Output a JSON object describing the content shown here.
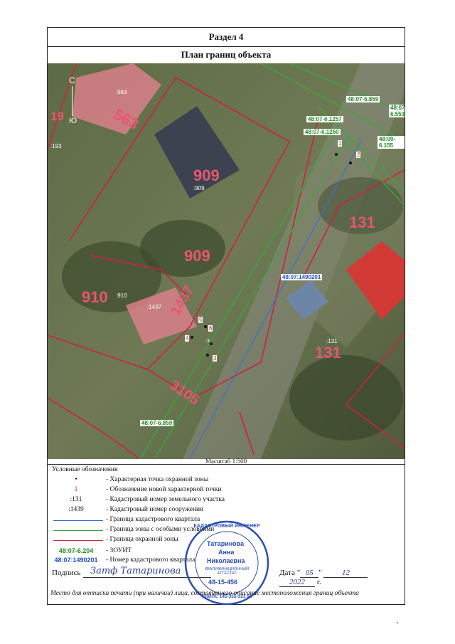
{
  "section": "Раздел 4",
  "title": "План границ объекта",
  "scale": "Масштаб 1:500",
  "legend": {
    "title": "Условные обозначения",
    "items": [
      {
        "symbol": "•",
        "text": "- Характерная точка охранной зоны"
      },
      {
        "symbol": "1",
        "text": "- Обозначение новой характерной точки"
      },
      {
        "symbol": ":131",
        "text": "- Кадастровый номер земельного участка"
      },
      {
        "symbol": ":1439",
        "text": "- Кадастровый номер сооружения"
      },
      {
        "symbol": "",
        "text": "- Граница кадастрового квартала"
      },
      {
        "symbol": "",
        "text": "- Граница зоны с особыми условиями"
      },
      {
        "symbol": "",
        "text": "- Граница охранной зоны"
      },
      {
        "symbol": "48:07-6.204",
        "text": "- ЗОУИТ"
      },
      {
        "symbol": "48:07:1490201",
        "text": "- Номер кадастрового квартала"
      }
    ]
  },
  "map": {
    "north": "С",
    "south": "Ю",
    "zones": [
      "48:07-6.859",
      "48:07-6.553",
      "48:07-6.1257",
      "48:07-6.1260",
      "48:00-6.155",
      "48:07-6.859"
    ],
    "quarter": "48:07:1490201",
    "parcels": [
      {
        "big": "563",
        "small": ":563"
      },
      {
        "big": "19",
        "small": ":193"
      },
      {
        "big": "909",
        "small": ":909"
      },
      {
        "big": "909",
        "small": ""
      },
      {
        "big": "910",
        "small": ":910"
      },
      {
        "big": "1437",
        "small": ":1437"
      },
      {
        "big": "131",
        "small": ""
      },
      {
        "big": "131",
        "small": ":131"
      },
      {
        "big": "3105",
        "small": ""
      }
    ],
    "points": [
      "1",
      "2",
      "3",
      "4",
      "5",
      "6"
    ],
    "extra": ":3"
  },
  "signature": {
    "label": "Подпись",
    "scribble": "Затф Татаринова",
    "date_label": "Дата",
    "day": "05",
    "month": "12",
    "year": "2022",
    "suffix": "г."
  },
  "stamp": {
    "ring_top": "КАДАСТРОВЫЙ ИНЖЕНЕР",
    "ring_bottom": "СНИЛС 145-355-323 94",
    "name1": "Татаринова",
    "name2": "Анна",
    "name3": "Николаевна",
    "cert": "КВАЛИФИКАЦИОННЫЙ АТТЕСТАТ",
    "number": "48-15-456"
  },
  "footer": "Место для оттиска печати (при наличии) лица, составившего описание местоположения границ объекта",
  "colors": {
    "quarter_line": "#3a6fd8",
    "zone_line": "#3aa83a",
    "guard_line": "#d02040",
    "zone_text": "#1f8a1f",
    "quarter_text": "#2050c8",
    "stamp": "#2a4db5"
  }
}
